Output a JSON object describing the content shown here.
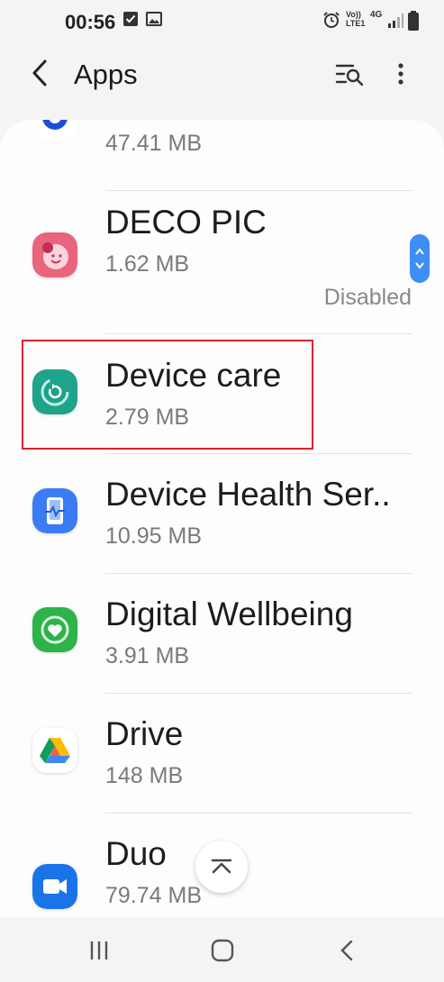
{
  "status_bar": {
    "time": "00:56",
    "network_top": "Vo))",
    "network_bottom": "LTE1",
    "network_type": "4G"
  },
  "header": {
    "title": "Apps",
    "back_icon": "back-arrow-icon",
    "search_icon": "filter-search-icon",
    "more_icon": "more-vertical-icon"
  },
  "apps": [
    {
      "name": "",
      "size": "47.41 MB",
      "icon": "partial-app-icon"
    },
    {
      "name": "DECO PIC",
      "size": "1.62 MB",
      "status": "Disabled",
      "icon": "deco-pic-icon"
    },
    {
      "name": "Device care",
      "size": "2.79 MB",
      "icon": "device-care-icon"
    },
    {
      "name": "Device Health Ser..",
      "size": "10.95 MB",
      "icon": "device-health-icon"
    },
    {
      "name": "Digital Wellbeing",
      "size": "3.91 MB",
      "icon": "digital-wellbeing-icon"
    },
    {
      "name": "Drive",
      "size": "148 MB",
      "icon": "google-drive-icon"
    },
    {
      "name": "Duo",
      "size": "79.74 MB",
      "icon": "duo-icon"
    }
  ],
  "colors": {
    "highlight": "#d7232f",
    "scrollbar": "#3e8ef7"
  }
}
